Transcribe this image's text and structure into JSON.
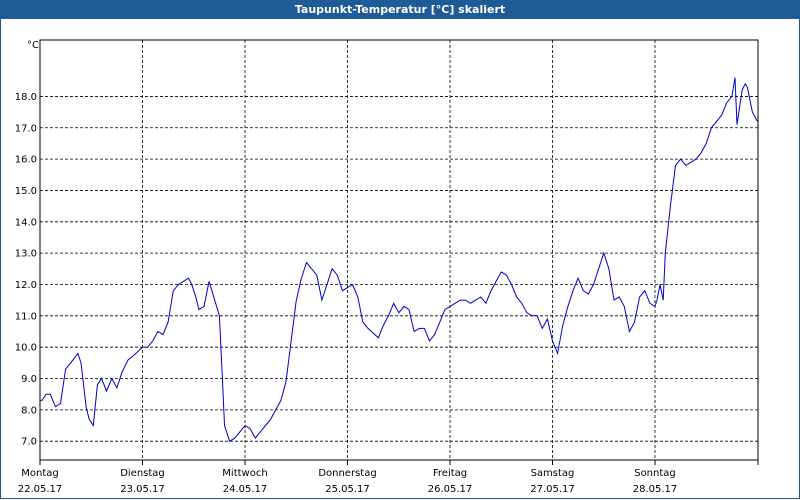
{
  "window": {
    "title": "Taupunkt-Temperatur [°C] skaliert"
  },
  "chart_data": {
    "type": "line",
    "title": "Taupunkt-Temperatur [°C] skaliert",
    "ylabel": "°C",
    "xlabel": "",
    "ylim": [
      6.4,
      19.8
    ],
    "yticks": [
      "7.0",
      "8.0",
      "9.0",
      "10.0",
      "11.0",
      "12.0",
      "13.0",
      "14.0",
      "15.0",
      "16.0",
      "17.0",
      "18.0"
    ],
    "ytick_values": [
      7,
      8,
      9,
      10,
      11,
      12,
      13,
      14,
      15,
      16,
      17,
      18
    ],
    "xlim": [
      0,
      7
    ],
    "days": [
      {
        "name": "Montag",
        "date": "22.05.17"
      },
      {
        "name": "Dienstag",
        "date": "23.05.17"
      },
      {
        "name": "Mittwoch",
        "date": "24.05.17"
      },
      {
        "name": "Donnerstag",
        "date": "25.05.17"
      },
      {
        "name": "Freitag",
        "date": "26.05.17"
      },
      {
        "name": "Samstag",
        "date": "27.05.17"
      },
      {
        "name": "Sonntag",
        "date": "28.05.17"
      }
    ],
    "grid": true,
    "series": [
      {
        "color": "#0000cc",
        "x": [
          0.0,
          0.02,
          0.06,
          0.1,
          0.15,
          0.2,
          0.25,
          0.3,
          0.37,
          0.4,
          0.45,
          0.48,
          0.52,
          0.56,
          0.6,
          0.65,
          0.7,
          0.75,
          0.8,
          0.86,
          0.9,
          1.0,
          1.05,
          1.1,
          1.15,
          1.2,
          1.25,
          1.3,
          1.35,
          1.4,
          1.45,
          1.48,
          1.52,
          1.55,
          1.6,
          1.65,
          1.75,
          1.78,
          1.8,
          1.85,
          1.9,
          1.95,
          2.0,
          2.05,
          2.1,
          2.15,
          2.2,
          2.25,
          2.35,
          2.4,
          2.5,
          2.55,
          2.6,
          2.7,
          2.75,
          2.85,
          2.9,
          2.95,
          3.0,
          3.05,
          3.1,
          3.15,
          3.2,
          3.3,
          3.35,
          3.4,
          3.45,
          3.5,
          3.55,
          3.6,
          3.65,
          3.7,
          3.75,
          3.8,
          3.85,
          3.9,
          3.95,
          4.0,
          4.05,
          4.1,
          4.15,
          4.2,
          4.25,
          4.3,
          4.35,
          4.4,
          4.45,
          4.5,
          4.55,
          4.6,
          4.65,
          4.7,
          4.75,
          4.8,
          4.85,
          4.9,
          4.95,
          5.0,
          5.05,
          5.1,
          5.15,
          5.2,
          5.25,
          5.3,
          5.35,
          5.4,
          5.45,
          5.5,
          5.55,
          5.6,
          5.65,
          5.7,
          5.75,
          5.8,
          5.85,
          5.9,
          5.95,
          6.0,
          6.02,
          6.05,
          6.08,
          6.1,
          6.15,
          6.2,
          6.25,
          6.3,
          6.35,
          6.4,
          6.45,
          6.5,
          6.55,
          6.6,
          6.65,
          6.7,
          6.75,
          6.78,
          6.8,
          6.85,
          6.88,
          6.9,
          6.95,
          7.0
        ],
        "y": [
          8.3,
          8.3,
          8.5,
          8.5,
          8.1,
          8.2,
          9.3,
          9.5,
          9.8,
          9.5,
          8.1,
          7.7,
          7.5,
          8.8,
          9.0,
          8.6,
          9.0,
          8.7,
          9.2,
          9.6,
          9.7,
          10.0,
          10.0,
          10.2,
          10.5,
          10.4,
          10.8,
          11.8,
          12.0,
          12.1,
          12.2,
          12.0,
          11.6,
          11.2,
          11.3,
          12.1,
          11.0,
          9.0,
          7.5,
          7.0,
          7.1,
          7.3,
          7.5,
          7.4,
          7.1,
          7.3,
          7.5,
          7.7,
          8.3,
          8.9,
          11.5,
          12.2,
          12.7,
          12.3,
          11.5,
          12.5,
          12.3,
          11.8,
          11.9,
          12.0,
          11.6,
          10.8,
          10.6,
          10.3,
          10.7,
          11.0,
          11.4,
          11.1,
          11.3,
          11.2,
          10.5,
          10.6,
          10.6,
          10.2,
          10.4,
          10.8,
          11.2,
          11.3,
          11.4,
          11.5,
          11.5,
          11.4,
          11.5,
          11.6,
          11.4,
          11.8,
          12.1,
          12.4,
          12.3,
          12.0,
          11.6,
          11.4,
          11.1,
          11.0,
          11.0,
          10.6,
          10.9,
          10.2,
          9.8,
          10.7,
          11.3,
          11.8,
          12.2,
          11.8,
          11.7,
          12.0,
          12.5,
          13.0,
          12.5,
          11.5,
          11.6,
          11.3,
          10.5,
          10.8,
          11.6,
          11.8,
          11.4,
          11.3,
          11.5,
          12.0,
          11.5,
          13.0,
          14.5,
          15.8,
          16.0,
          15.8,
          15.9,
          16.0,
          16.2,
          16.5,
          17.0,
          17.2,
          17.4,
          17.8,
          18.0,
          18.6,
          17.1,
          18.2,
          18.4,
          18.3,
          17.5,
          17.2
        ]
      }
    ]
  }
}
